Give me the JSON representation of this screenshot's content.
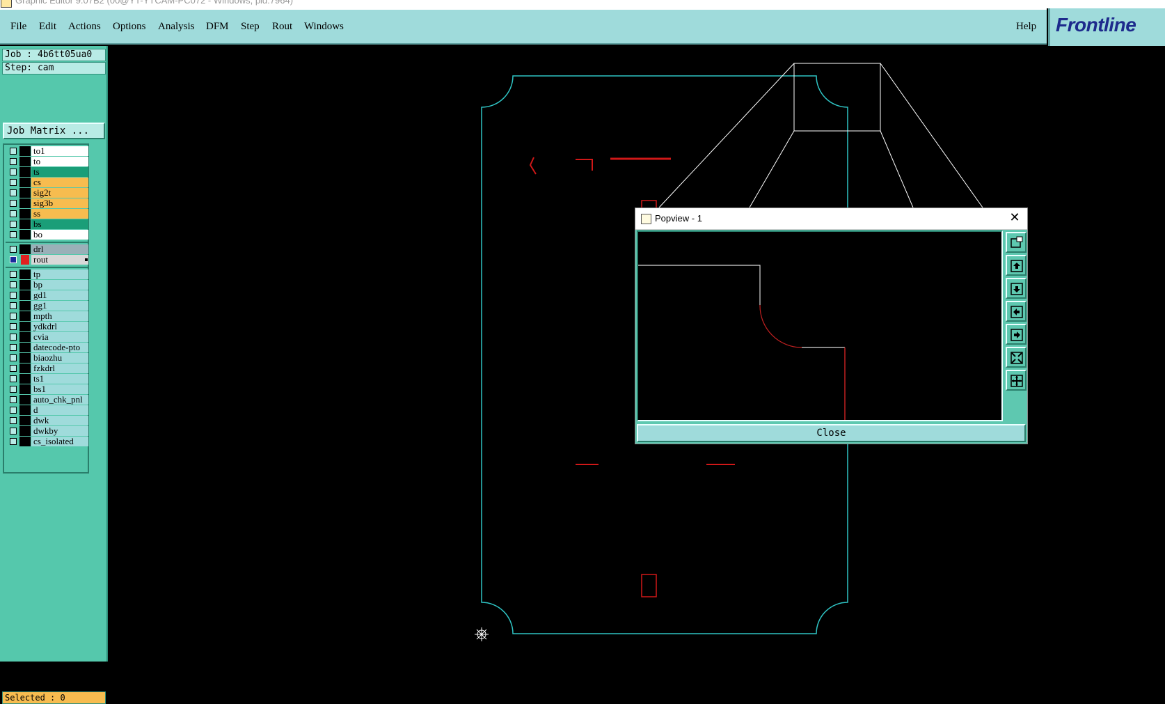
{
  "window": {
    "title": "Graphic Editor 9.07B2 (00@YT-YTCAM-PC072 - Windows, pid:7964)"
  },
  "menu": {
    "items": [
      "File",
      "Edit",
      "Actions",
      "Options",
      "Analysis",
      "DFM",
      "Step",
      "Rout",
      "Windows"
    ],
    "help": "Help"
  },
  "logo": {
    "text": "Frontline"
  },
  "info": {
    "job": "Job : 4b6tt05ua0",
    "step": "Step: cam",
    "job_matrix": "Job Matrix ..."
  },
  "layers": {
    "board": [
      {
        "name": "to1",
        "color": "#ffffff"
      },
      {
        "name": "to",
        "color": "#ffffff"
      },
      {
        "name": "ts",
        "color": "#1a9e78"
      },
      {
        "name": "cs",
        "color": "#f7bc4f"
      },
      {
        "name": "sig2t",
        "color": "#f7bc4f"
      },
      {
        "name": "sig3b",
        "color": "#f7bc4f"
      },
      {
        "name": "ss",
        "color": "#f7bc4f"
      },
      {
        "name": "bs",
        "color": "#1a9e78"
      },
      {
        "name": "bo",
        "color": "#ffffff"
      }
    ],
    "drill": [
      {
        "name": "drl",
        "color": "#9ab0b8",
        "active": false
      },
      {
        "name": "rout",
        "color": "#d8d8d8",
        "active": true
      }
    ],
    "misc": [
      {
        "name": "tp"
      },
      {
        "name": "bp"
      },
      {
        "name": "gd1"
      },
      {
        "name": "gg1"
      },
      {
        "name": "mpth"
      },
      {
        "name": "ydkdrl"
      },
      {
        "name": "cvia"
      },
      {
        "name": "datecode-pto"
      },
      {
        "name": "biaozhu"
      },
      {
        "name": "fzkdrl"
      },
      {
        "name": "ts1"
      },
      {
        "name": "bs1"
      },
      {
        "name": "auto_chk_pnl"
      },
      {
        "name": "d"
      },
      {
        "name": "dwk"
      },
      {
        "name": "dwkby"
      },
      {
        "name": "cs_isolated"
      }
    ],
    "misc_color": "#9fdbdb"
  },
  "status": {
    "selected": "Selected : 0"
  },
  "popview": {
    "title": "Popview - 1",
    "close_label": "Close",
    "tools": [
      "zoom-home-icon",
      "pan-up-icon",
      "pan-down-icon",
      "pan-left-icon",
      "pan-right-icon",
      "zoom-out-icon",
      "zoom-in-icon"
    ]
  },
  "colors": {
    "outline": "#2fc4c4",
    "rout": "#d01818",
    "zoom_box": "#ffffff"
  }
}
